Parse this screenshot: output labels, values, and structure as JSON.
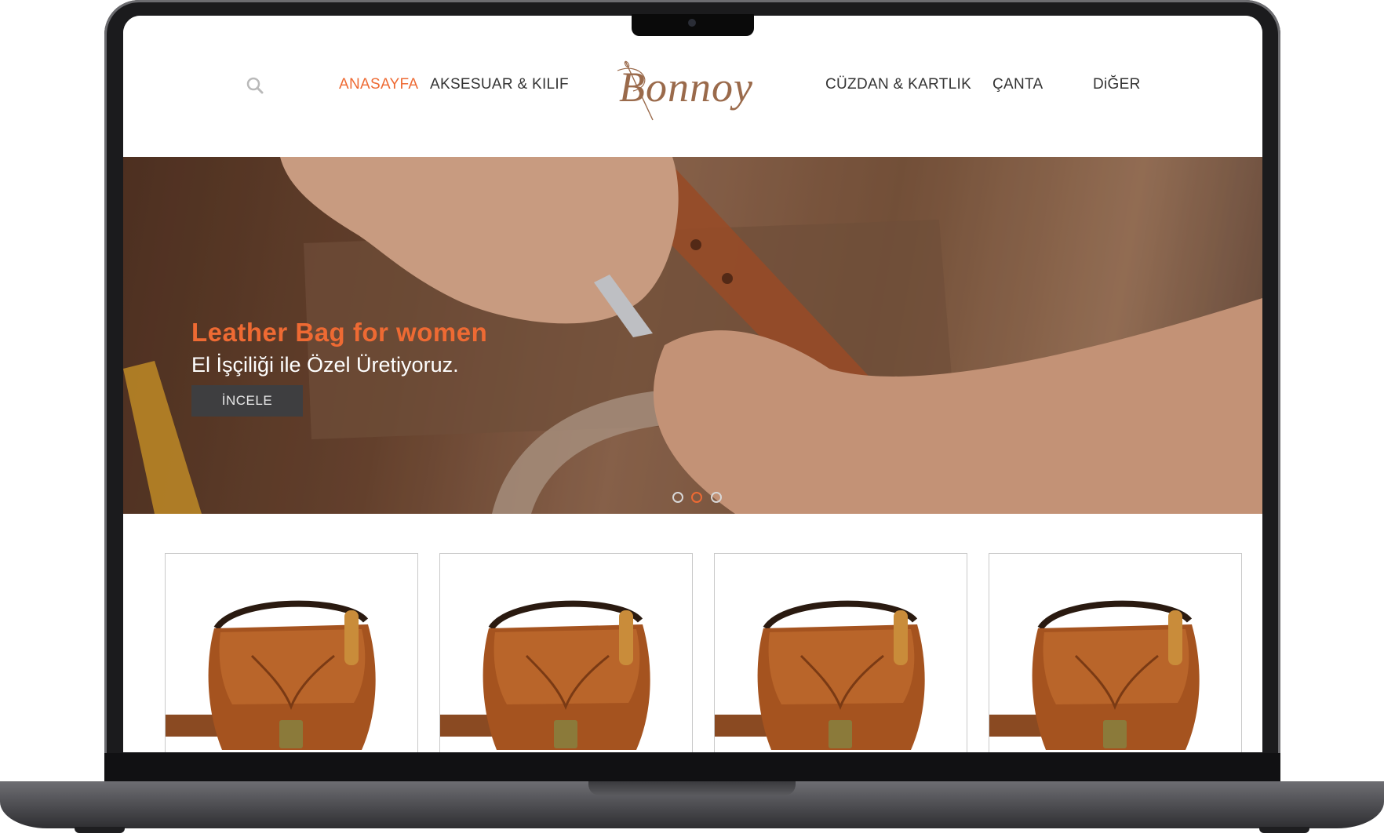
{
  "nav": {
    "search_icon": "search-icon",
    "items": [
      {
        "label": "ANASAYFA",
        "active": true
      },
      {
        "label": "AKSESUAR & KILIF",
        "active": false
      },
      {
        "label": "CÜZDAN & KARTLIK",
        "active": false
      },
      {
        "label": "ÇANTA",
        "active": false
      },
      {
        "label": "DiĞER",
        "active": false
      }
    ],
    "logo_text": "Bonnoy"
  },
  "hero": {
    "title": "Leather Bag for women",
    "subtitle": "El İşçiliği ile Özel Üretiyoruz.",
    "button_label": "İNCELE",
    "slides": 3,
    "active_slide": 2
  },
  "products": [
    {
      "image": "leather-saddle-bag"
    },
    {
      "image": "leather-saddle-bag"
    },
    {
      "image": "leather-saddle-bag"
    },
    {
      "image": "leather-saddle-bag"
    }
  ],
  "colors": {
    "accent": "#ee6a33",
    "nav_text": "#333333",
    "button_bg": "#3e3e40",
    "logo": "#9a6a4b"
  }
}
